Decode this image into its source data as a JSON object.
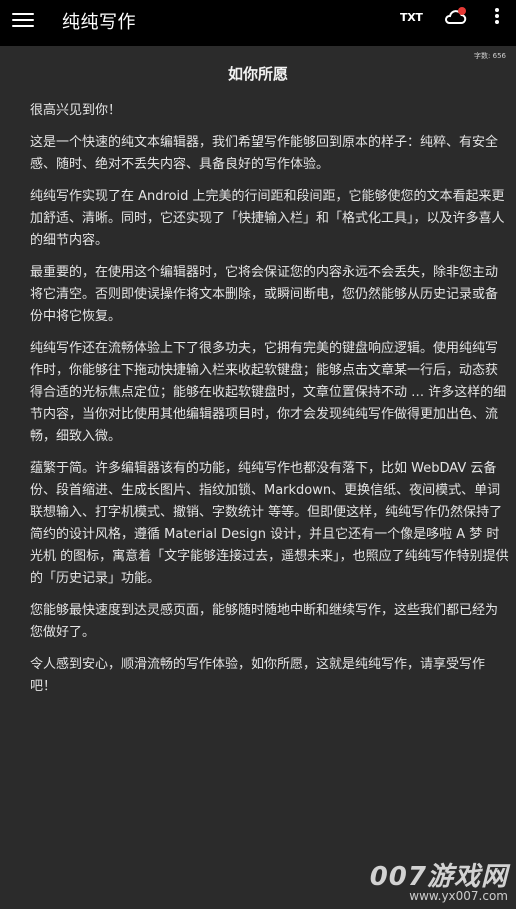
{
  "appbar": {
    "title": "纯纯写作",
    "txt_label": "TXT",
    "menu_icon": "hamburger-menu-icon",
    "cloud_icon": "cloud-sync-icon",
    "more_icon": "more-vert-icon",
    "badge_color": "#e53935"
  },
  "document": {
    "word_count": "字数: 656",
    "title": "如你所愿",
    "paragraphs": [
      "很高兴见到你！",
      "这是一个快速的纯文本编辑器，我们希望写作能够回到原本的样子：纯粹、有安全感、随时、绝对不丢失内容、具备良好的写作体验。",
      "纯纯写作实现了在 Android 上完美的行间距和段间距，它能够使您的文本看起来更加舒适、清晰。同时，它还实现了「快捷输入栏」和「格式化工具」，以及许多喜人的细节内容。",
      "最重要的，在使用这个编辑器时，它将会保证您的内容永远不会丢失，除非您主动将它清空。否则即使误操作将文本删除，或瞬间断电，您仍然能够从历史记录或备份中将它恢复。",
      "纯纯写作还在流畅体验上下了很多功夫，它拥有完美的键盘响应逻辑。使用纯纯写作时，你能够往下拖动快捷输入栏来收起软键盘；能够点击文章某一行后，动态获得合适的光标焦点定位；能够在收起软键盘时，文章位置保持不动 … 许多这样的细节内容，当你对比使用其他编辑器项目时，你才会发现纯纯写作做得更加出色、流畅，细致入微。",
      "蕴繁于简。许多编辑器该有的功能，纯纯写作也都没有落下，比如 WebDAV 云备份、段首缩进、生成长图片、指纹加锁、Markdown、更换信纸、夜间模式、单词联想输入、打字机模式、撤销、字数统计 等等。但即便这样，纯纯写作仍然保持了简约的设计风格，遵循 Material Design 设计，并且它还有一个像是哆啦 A 梦 时光机 的图标，寓意着「文字能够连接过去，遥想未来」，也照应了纯纯写作特别提供的「历史记录」功能。",
      "您能够最快速度到达灵感页面，能够随时随地中断和继续写作，这些我们都已经为您做好了。",
      "令人感到安心，顺滑流畅的写作体验，如你所愿，这就是纯纯写作，请享受写作吧！"
    ]
  },
  "watermark": {
    "line1": "007游戏网",
    "line2": "www.yx007.com"
  }
}
